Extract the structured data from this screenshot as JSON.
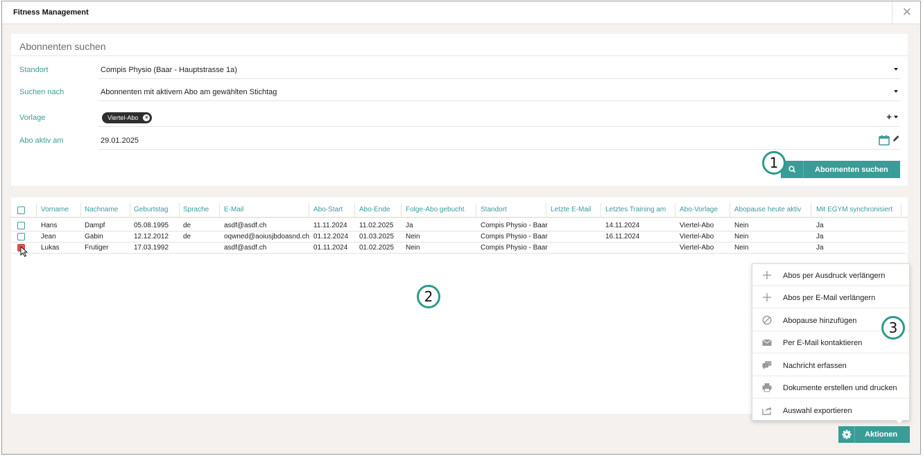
{
  "window": {
    "title": "Fitness Management",
    "close_label": "✕"
  },
  "search_panel": {
    "title": "Abonnenten suchen",
    "fields": {
      "standort": {
        "label": "Standort",
        "value": "Compis Physio (Baar - Hauptstrasse 1a)"
      },
      "suchen_nach": {
        "label": "Suchen nach",
        "value": "Abonnenten mit aktivem Abo am gewählten Stichtag"
      },
      "vorlage": {
        "label": "Vorlage",
        "chip": "Viertel-Abo"
      },
      "abo_aktiv_am": {
        "label": "Abo aktiv am",
        "value": "29.01.2025"
      }
    },
    "search_button": "Abonnenten suchen"
  },
  "badges": {
    "one": "1",
    "two": "2",
    "three": "3"
  },
  "table": {
    "headers": [
      "Vorname",
      "Nachname",
      "Geburtstag",
      "Sprache",
      "E-Mail",
      "Abo-Start",
      "Abo-Ende",
      "Folge-Abo gebucht",
      "Standort",
      "Letzte E-Mail",
      "Letztes Training am",
      "Abo-Vorlage",
      "Abopause heute aktiv",
      "Mit EGYM synchronisiert"
    ],
    "rows": [
      [
        "Hans",
        "Dampf",
        "05.08.1995",
        "de",
        "asdf@asdf.ch",
        "11.11.2024",
        "11.02.2025",
        "Ja",
        "Compis Physio - Baar",
        "",
        "14.11.2024",
        "Viertel-Abo",
        "Nein",
        "Ja"
      ],
      [
        "Jean",
        "Gabin",
        "12.12.2012",
        "de",
        "oqwned@aoiusjbdoasnd.ch",
        "01.12.2024",
        "01.03.2025",
        "Nein",
        "Compis Physio - Baar",
        "",
        "16.11.2024",
        "Viertel-Abo",
        "Nein",
        "Ja"
      ],
      [
        "Lukas",
        "Frutiger",
        "17.03.1992",
        "",
        "asdf@asdf.ch",
        "01.11.2024",
        "01.02.2025",
        "Nein",
        "Compis Physio - Baar",
        "",
        "",
        "Viertel-Abo",
        "Nein",
        "Ja"
      ]
    ]
  },
  "actions_menu": {
    "items": [
      {
        "label": "Abos per Ausdruck verlängern",
        "icon": "plus-icon"
      },
      {
        "label": "Abos per E-Mail verlängern",
        "icon": "plus-icon"
      },
      {
        "label": "Abopause hinzufügen",
        "icon": "ban-icon"
      },
      {
        "label": "Per E-Mail kontaktieren",
        "icon": "envelope-icon"
      },
      {
        "label": "Nachricht erfassen",
        "icon": "comments-icon"
      },
      {
        "label": "Dokumente erstellen und drucken",
        "icon": "print-icon"
      },
      {
        "label": "Auswahl exportieren",
        "icon": "export-icon"
      }
    ],
    "button": "Aktionen"
  },
  "colors": {
    "accent": "#3a9c96",
    "badge_ring": "#2d9a8a",
    "selected_checkbox": "#e05555"
  }
}
